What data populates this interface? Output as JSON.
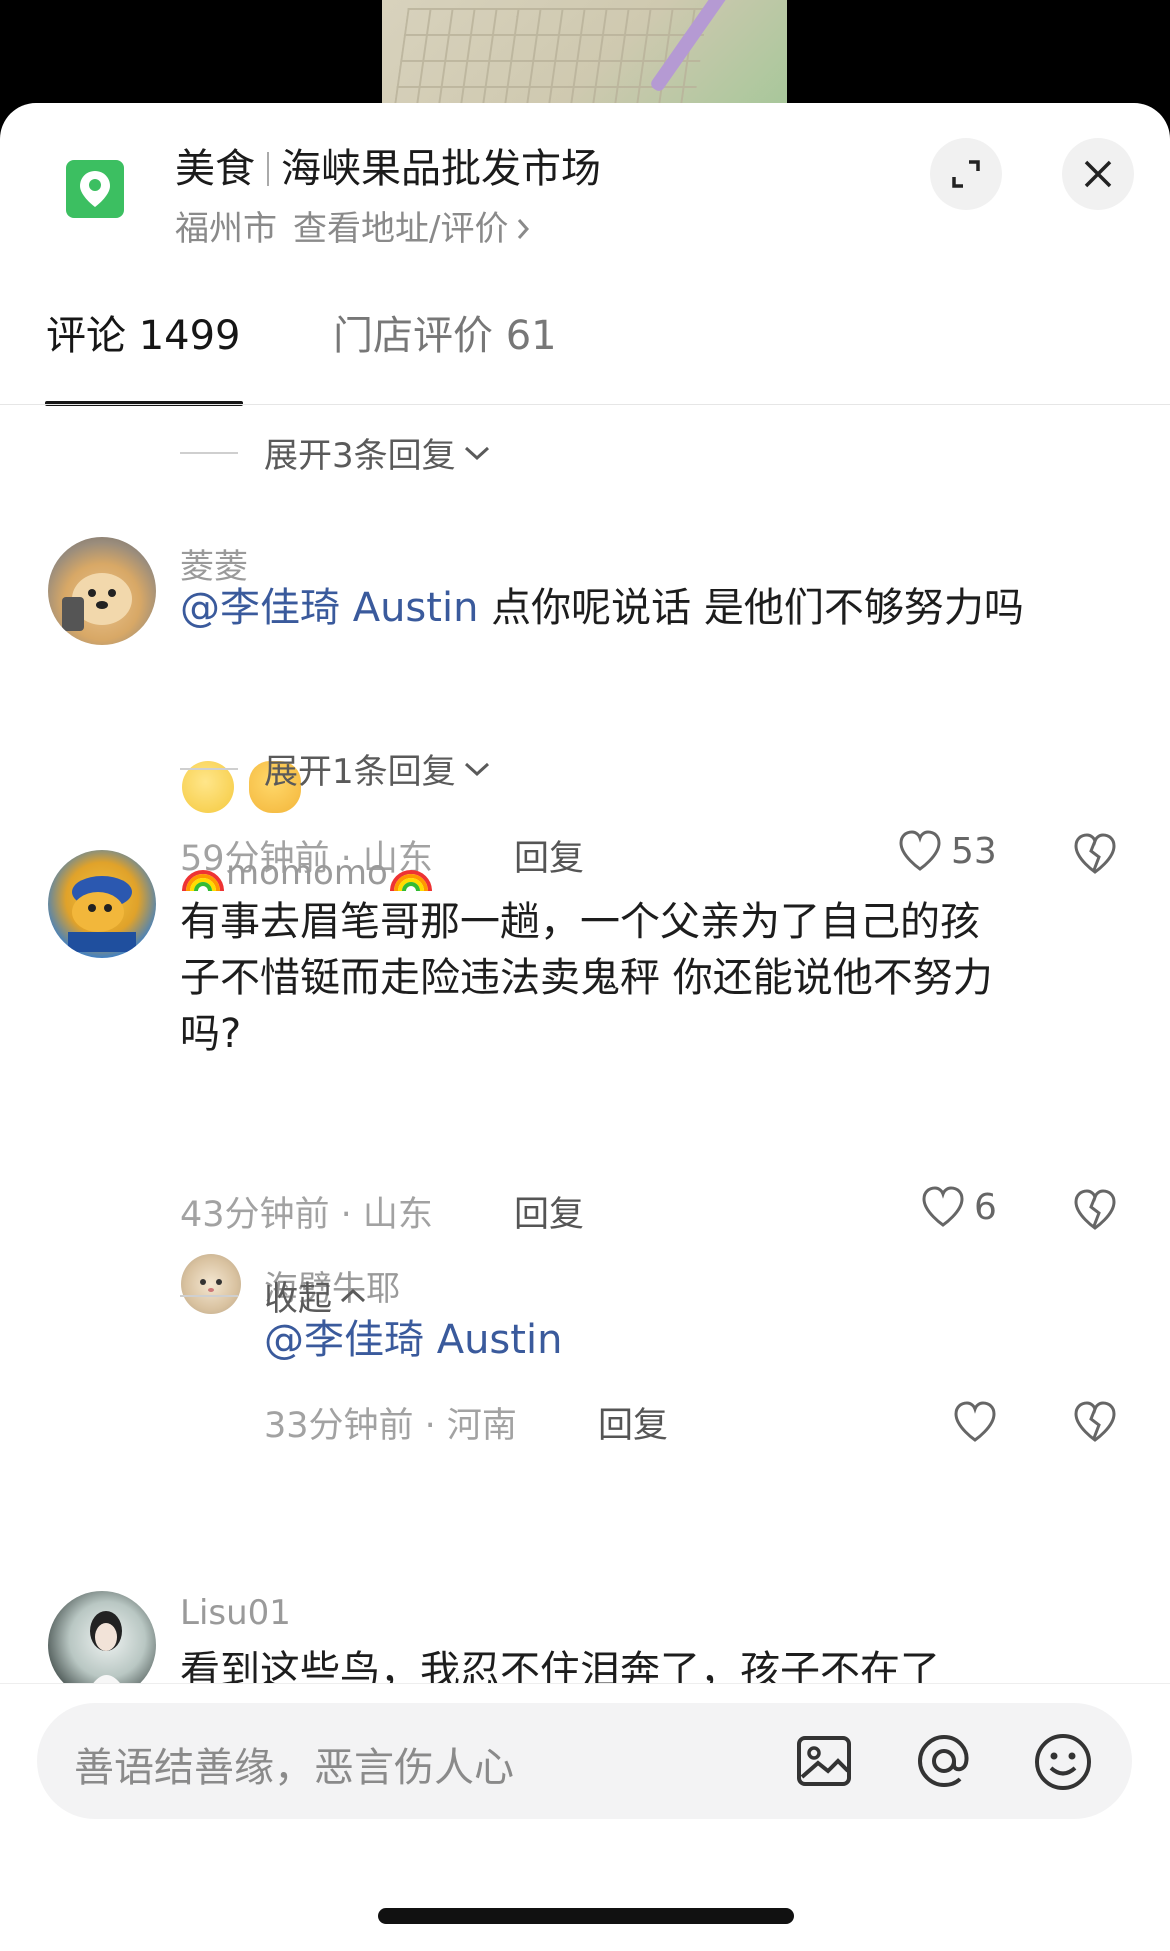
{
  "header": {
    "category": "美食",
    "title": "海峡果品批发市场",
    "city": "福州市",
    "address_link": "查看地址/评价",
    "accent_color": "#3cbf61"
  },
  "tabs": [
    {
      "label": "评论 1499",
      "active": true
    },
    {
      "label": "门店评价 61",
      "active": false
    }
  ],
  "comments_section": {
    "expand_1": "展开3条回复",
    "comment_1": {
      "username": "菱菱",
      "mention": "@李佳琦 Austin",
      "text": " 点你呢说话 是他们不够努力吗",
      "time": "59分钟前 · 山东",
      "reply_label": "回复",
      "likes": "53"
    },
    "expand_2": "展开1条回复",
    "comment_2": {
      "username": "momomo",
      "line1": "有事去眉笔哥那一趟，一个父亲为了自己的孩",
      "line2": "子不惜铤而走险违法卖鬼秤 你还能说他不努力",
      "line3": "吗?",
      "time": "43分钟前 · 山东",
      "reply_label": "回复",
      "likes": "6"
    },
    "reply_1": {
      "username": "海劈牛耶",
      "mention": "@李佳琦 Austin",
      "time": "33分钟前 · 河南",
      "reply_label": "回复"
    },
    "collapse": "收起",
    "comment_3": {
      "username": "Lisu01",
      "text": "看到这些鸟，我忍不住泪奔了，孩子不在了"
    }
  },
  "input": {
    "placeholder": "善语结善缘，恶言伤人心"
  },
  "icons": {
    "location": "location-pin-icon",
    "expand": "expand-icon",
    "close": "close-icon",
    "heart": "heart-icon",
    "dislike": "broken-heart-icon",
    "image": "image-icon",
    "at": "at-icon",
    "emoji": "emoji-icon"
  }
}
